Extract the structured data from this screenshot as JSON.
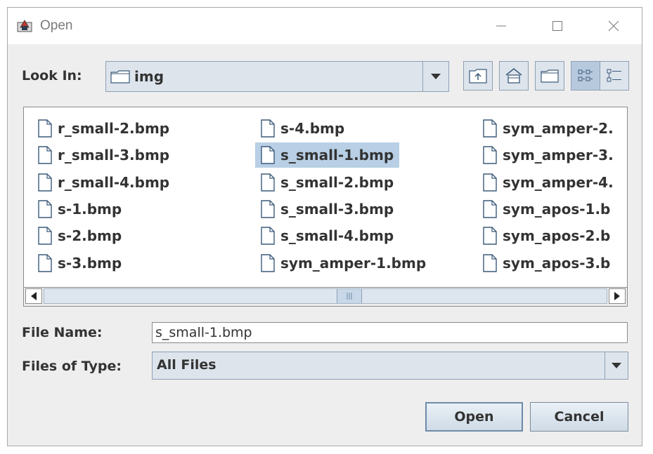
{
  "window": {
    "title": "Open"
  },
  "look_in": {
    "label": "Look In:",
    "value": "img"
  },
  "toolbar": {
    "icons": [
      "up-one-level-icon",
      "home-icon",
      "new-folder-icon",
      "list-view-icon",
      "details-view-icon"
    ],
    "active_view": "list-view"
  },
  "files": [
    {
      "name": "r_small-2.bmp",
      "selected": false
    },
    {
      "name": "r_small-3.bmp",
      "selected": false
    },
    {
      "name": "r_small-4.bmp",
      "selected": false
    },
    {
      "name": "s-1.bmp",
      "selected": false
    },
    {
      "name": "s-2.bmp",
      "selected": false
    },
    {
      "name": "s-3.bmp",
      "selected": false
    },
    {
      "name": "s-4.bmp",
      "selected": false
    },
    {
      "name": "s_small-1.bmp",
      "selected": true
    },
    {
      "name": "s_small-2.bmp",
      "selected": false
    },
    {
      "name": "s_small-3.bmp",
      "selected": false
    },
    {
      "name": "s_small-4.bmp",
      "selected": false
    },
    {
      "name": "sym_amper-1.bmp",
      "selected": false
    },
    {
      "name": "sym_amper-2.",
      "selected": false
    },
    {
      "name": "sym_amper-3.",
      "selected": false
    },
    {
      "name": "sym_amper-4.",
      "selected": false
    },
    {
      "name": "sym_apos-1.b",
      "selected": false
    },
    {
      "name": "sym_apos-2.b",
      "selected": false
    },
    {
      "name": "sym_apos-3.b",
      "selected": false
    }
  ],
  "file_name": {
    "label": "File Name:",
    "value": "s_small-1.bmp"
  },
  "files_of_type": {
    "label": "Files of Type:",
    "value": "All Files"
  },
  "buttons": {
    "open": "Open",
    "cancel": "Cancel"
  },
  "colors": {
    "selection": "#b8cfe5",
    "accent": "#6d8aa8"
  }
}
